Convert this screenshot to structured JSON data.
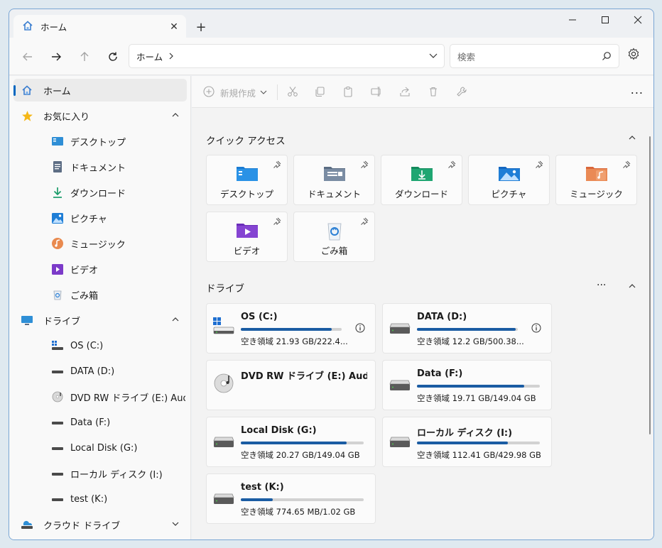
{
  "window": {
    "tab_title": "ホーム",
    "new_tab": "+"
  },
  "nav": {
    "address": "ホーム",
    "search_placeholder": "検索"
  },
  "sidebar": {
    "home": "ホーム",
    "favorites": "お気に入り",
    "fav_items": [
      "デスクトップ",
      "ドキュメント",
      "ダウンロード",
      "ピクチャ",
      "ミュージック",
      "ビデオ",
      "ごみ箱"
    ],
    "drives": "ドライブ",
    "drive_items": [
      "OS (C:)",
      "DATA (D:)",
      "DVD RW ドライブ (E:) Aud",
      "Data (F:)",
      "Local Disk (G:)",
      "ローカル ディスク (I:)",
      "test (K:)"
    ],
    "cloud": "クラウド ドライブ"
  },
  "toolbar": {
    "new_label": "新規作成",
    "more": "..."
  },
  "quick_access": {
    "title": "クイック アクセス",
    "items": [
      "デスクトップ",
      "ドキュメント",
      "ダウンロード",
      "ピクチャ",
      "ミュージック",
      "ビデオ",
      "ごみ箱"
    ]
  },
  "drives_section": {
    "title": "ドライブ",
    "more": "...",
    "items": [
      {
        "name": "OS (C:)",
        "free": "空き領域 21.93 GB/222.4...",
        "used": 0.9
      },
      {
        "name": "DATA (D:)",
        "free": "空き領域 12.2 GB/500.38...",
        "used": 0.98
      },
      {
        "name": "DVD RW ドライブ (E:) Audi...",
        "free": "",
        "used": 0
      },
      {
        "name": "Data (F:)",
        "free": "空き領域 19.71 GB/149.04 GB",
        "used": 0.87
      },
      {
        "name": "Local Disk (G:)",
        "free": "空き領域 20.27 GB/149.04 GB",
        "used": 0.86
      },
      {
        "name": "ローカル ディスク (I:)",
        "free": "空き領域 112.41 GB/429.98 GB",
        "used": 0.74
      },
      {
        "name": "test (K:)",
        "free": "空き領域 774.65 MB/1.02 GB",
        "used": 0.26
      }
    ]
  },
  "colors": {
    "accent": "#0067c0",
    "bar": "#1a5ca3"
  }
}
